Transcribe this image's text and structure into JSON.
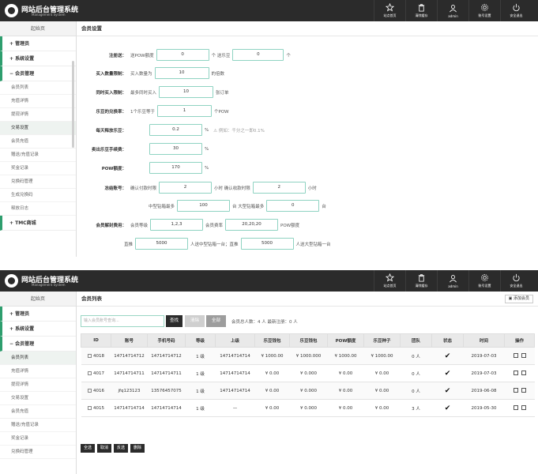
{
  "header": {
    "title": "网站后台管理系统",
    "subtitle": "Management System",
    "nav": [
      {
        "icon": "star-icon",
        "label": "站点首页"
      },
      {
        "icon": "trash-icon",
        "label": "清除缓存"
      },
      {
        "icon": "user-icon",
        "label": "admin"
      },
      {
        "icon": "gear-icon",
        "label": "账号设置"
      },
      {
        "icon": "power-icon",
        "label": "安全退出"
      }
    ]
  },
  "sidebar1": {
    "home": "起始页",
    "g1": "+ 管理员",
    "g2": "+ 系统设置",
    "g3": "− 会员管理",
    "items": [
      "会员列表",
      "充值详情",
      "提现详情",
      "交易设置",
      "会员充值",
      "赠送/充值记录",
      "奖金记录",
      "兑换码管理",
      "生成兑换码",
      "释放日志"
    ],
    "active_index": 3,
    "g4": "+ TMC商城"
  },
  "sidebar2": {
    "home": "起始页",
    "g1": "+ 管理员",
    "g2": "+ 系统设置",
    "g3": "− 会员管理",
    "items": [
      "会员列表",
      "充值详情",
      "提现详情",
      "交易设置",
      "会员充值",
      "赠送/充值记录",
      "奖金记录",
      "兑换码管理"
    ],
    "active_index": 0
  },
  "settings": {
    "panel_title": "会员设置",
    "register": {
      "label": "注册送：",
      "t1": "送POW额度",
      "v1": "0",
      "t2": "个 送乐豆",
      "v2": "0",
      "t3": "个"
    },
    "buy_limit": {
      "label": "买入数量限制：",
      "t1": "买入数量为",
      "v1": "10",
      "t2": "的倍数"
    },
    "simul_buy": {
      "label": "同时买入限制：",
      "t1": "最多同时买入",
      "v1": "10",
      "t2": "张订单"
    },
    "exchange": {
      "label": "乐豆的兑换率：",
      "t1": "1个乐豆等于",
      "v1": "1",
      "t2": "个POW"
    },
    "daily_release": {
      "label": "每天释放乐豆：",
      "v1": "0.2",
      "t2": "%",
      "hint": "⚠ 例如：千分之一即0.1%"
    },
    "sell_fee": {
      "label": "卖出乐豆手续费：",
      "v1": "30",
      "t2": "%"
    },
    "pow_quota": {
      "label": "POW额度：",
      "v1": "170",
      "t2": "%"
    },
    "freeze": {
      "label": "冻结账号：",
      "t1": "确认付款时限",
      "v1": "2",
      "t2": "小时 确认收款时限",
      "v2": "2",
      "t3": "小时"
    },
    "mining": {
      "t1": "中型钻箱最多",
      "v1": "100",
      "t2": "台 大型钻箱最多",
      "v2": "0",
      "t3": "台"
    },
    "unlock": {
      "label": "会员解封费用：",
      "t1": "会员等级",
      "v1": "1,2,3",
      "t2": "会员费率",
      "v2": "20,20,20",
      "t3": "POW额度"
    },
    "direct": {
      "t1": "直推",
      "v1": "5000",
      "t2": "人送中型钻箱一台；直推",
      "v2": "5000",
      "t3": "人送大型钻箱一台"
    }
  },
  "list": {
    "panel_title": "会员列表",
    "add_button": "▣ 添加会员",
    "search_placeholder": "输入会员账号查询...",
    "search_button": "查找",
    "btn_clear": "清除",
    "btn_all": "全部",
    "stats": "会员总人数：4 人 最新注册：0 人",
    "columns": [
      "ID",
      "账号",
      "手机号码",
      "等级",
      "上级",
      "乐豆钱包",
      "乐豆钱包",
      "POW额度",
      "乐豆种子",
      "团队",
      "状态",
      "时间",
      "操作"
    ],
    "rows": [
      {
        "id": "4018",
        "account": "14714714712",
        "phone": "14714714712",
        "level": "1 级",
        "parent": "14714714714",
        "wallet1": "¥ 1000.00",
        "wallet2": "¥ 1000.000",
        "pow": "¥ 1000.00",
        "seed": "¥ 1000.00",
        "team": "0 人",
        "status": "✔",
        "time": "2019-07-03"
      },
      {
        "id": "4017",
        "account": "14714714711",
        "phone": "14714714711",
        "level": "1 级",
        "parent": "14714714714",
        "wallet1": "¥ 0.00",
        "wallet2": "¥ 0.000",
        "pow": "¥ 0.00",
        "seed": "¥ 0.00",
        "team": "0 人",
        "status": "✔",
        "time": "2019-07-03"
      },
      {
        "id": "4016",
        "account": "jfq123123",
        "phone": "13576457075",
        "level": "1 级",
        "parent": "14714714714",
        "wallet1": "¥ 0.00",
        "wallet2": "¥ 0.000",
        "pow": "¥ 0.00",
        "seed": "¥ 0.00",
        "team": "0 人",
        "status": "✔",
        "time": "2019-06-08"
      },
      {
        "id": "4015",
        "account": "14714714714",
        "phone": "14714714714",
        "level": "1 级",
        "parent": "—",
        "wallet1": "¥ 0.00",
        "wallet2": "¥ 0.000",
        "pow": "¥ 0.00",
        "seed": "¥ 0.00",
        "team": "3 人",
        "status": "✔",
        "time": "2019-05-30"
      }
    ],
    "bulk": [
      "全选",
      "取消",
      "反选",
      "删除"
    ]
  }
}
